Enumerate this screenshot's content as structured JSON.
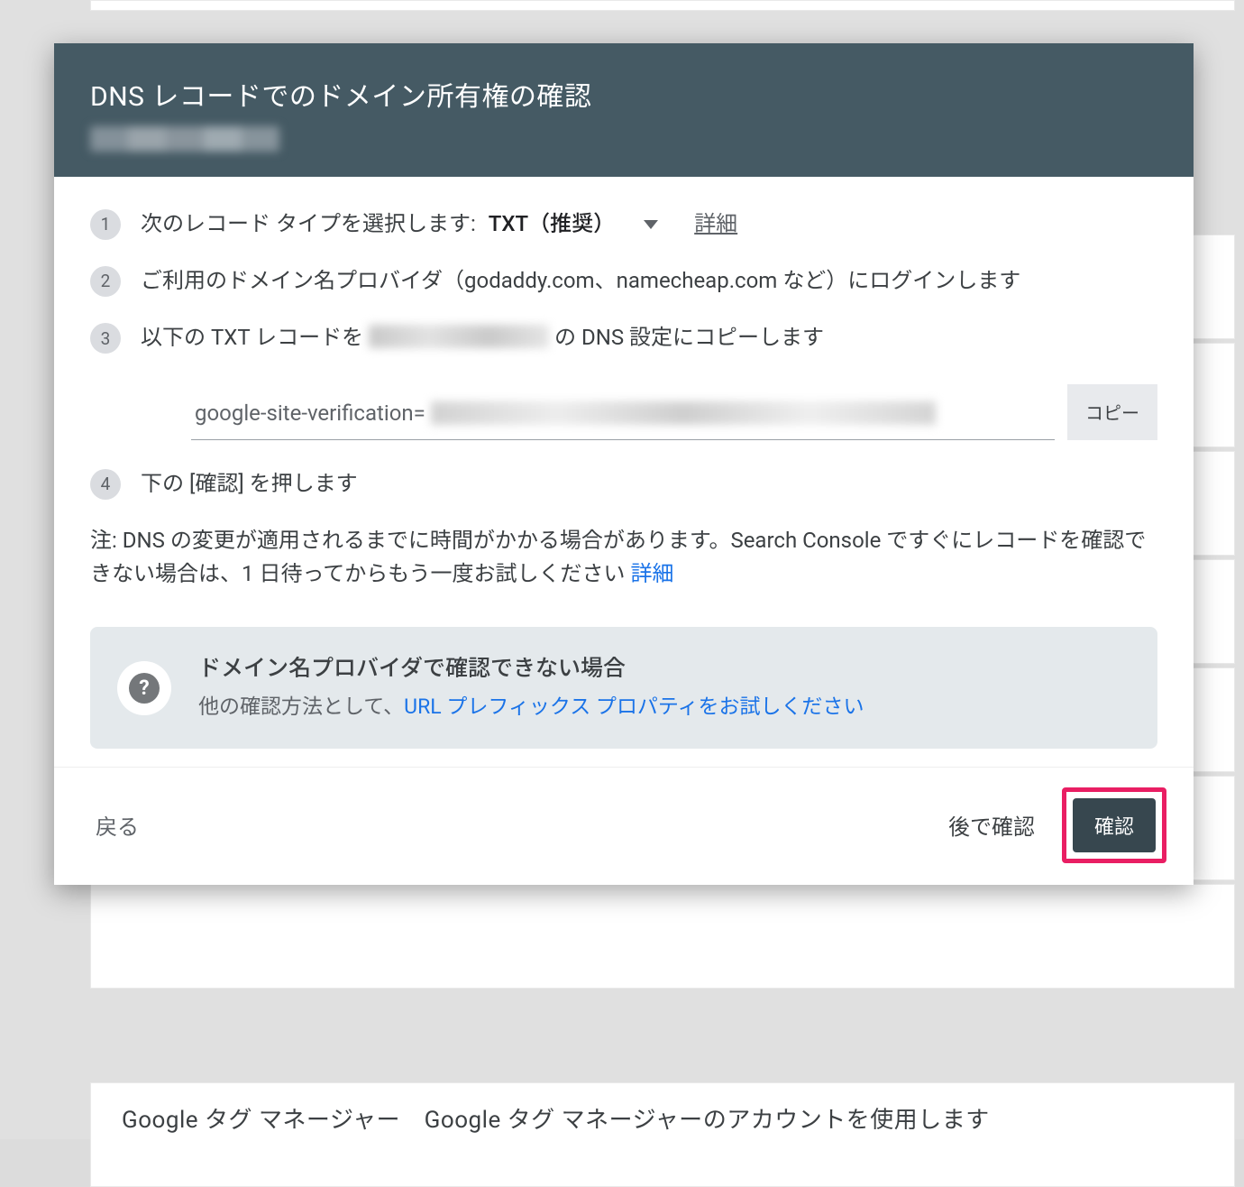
{
  "background": {
    "footer_text": "Google タグ マネージャー　Google タグ マネージャーのアカウントを使用します"
  },
  "dialog": {
    "title": "DNS レコードでのドメイン所有権の確認",
    "step1": {
      "label": "次のレコード タイプを選択します:",
      "selected_option": "TXT（推奨）",
      "details_label": "詳細"
    },
    "step2": {
      "text": "ご利用のドメイン名プロバイダ（godaddy.com、namecheap.com など）にログインします"
    },
    "step3": {
      "prefix": "以下の TXT レコードを ",
      "suffix": " の DNS 設定にコピーします"
    },
    "txt_record": {
      "prefix": "google-site-verification=",
      "copy_label": "コピー"
    },
    "step4": {
      "text": "下の [確認] を押します"
    },
    "note": {
      "text": "注: DNS の変更が適用されるまでに時間がかかる場合があります。Search Console ですぐにレコードを確認できない場合は、1 日待ってからもう一度お試しください ",
      "link": "詳細"
    },
    "info": {
      "title": "ドメイン名プロバイダで確認できない場合",
      "sub_prefix": "他の確認方法として、",
      "sub_link": "URL プレフィックス プロパティをお試しください"
    },
    "actions": {
      "back": "戻る",
      "later": "後で確認",
      "verify": "確認"
    }
  }
}
